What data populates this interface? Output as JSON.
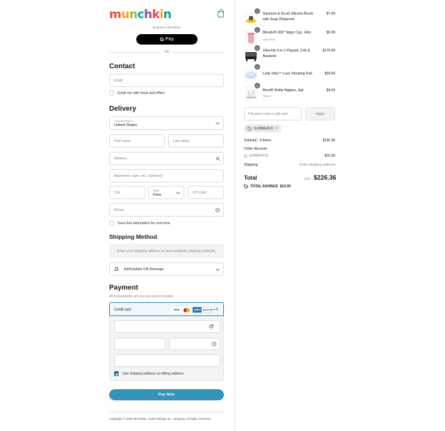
{
  "brand": {
    "logo_text": "munchkin",
    "logo_colors": [
      "#e94e3a",
      "#f7a21b",
      "#8bc43f",
      "#00a7a0",
      "#9c4a9c",
      "#e94e3a",
      "#f7a21b",
      "#00a7a0"
    ]
  },
  "express": {
    "label": "Express checkout",
    "gpay_label": "Pay",
    "gpay_g": "G",
    "or_label": "OR"
  },
  "contact": {
    "heading": "Contact",
    "email_placeholder": "Email",
    "newsletter_label": "Email me with news and offers"
  },
  "delivery": {
    "heading": "Delivery",
    "country_label": "Country/Region",
    "country_value": "United States",
    "first_name_ph": "First name",
    "last_name_ph": "Last name",
    "address_ph": "Address",
    "apartment_ph": "Apartment, suite, etc. (optional)",
    "city_ph": "City",
    "state_label": "State",
    "state_value": "Iowa",
    "zip_ph": "ZIP code",
    "phone_ph": "Phone",
    "save_info_label": "Save this information for next time"
  },
  "shipping": {
    "heading": "Shipping Method",
    "message": "Enter your shipping address to view available shipping methods.",
    "gift_label": "Add/Update Gift Message"
  },
  "payment": {
    "heading": "Payment",
    "note": "All transactions are secure and encrypted.",
    "credit_card_label": "Credit card",
    "cards": [
      "VISA",
      "MC",
      "AMEX",
      "DISCOVER"
    ],
    "more_cards": "+4",
    "billing_same_label": "Use shipping address as billing address",
    "pay_button": "Pay Now"
  },
  "footer": {
    "copyright": "Copyright © 2025 Munchkin, a Why Brands Inc. company. All rights reserved."
  },
  "cart": {
    "items": [
      {
        "qty": "1",
        "name": "Squeeze & Scrub Silicone Brush with Soap Dispenser",
        "variant": "",
        "price": "$7.99"
      },
      {
        "qty": "1",
        "name": "Miracle® 360° Sippy Cup, 14oz",
        "variant": "Light Pink",
        "price": "$9.99"
      },
      {
        "qty": "1",
        "name": "Ultra-lite 3-in-1 Playard, Crib & Bassinet",
        "variant": "",
        "price": "$179.99"
      },
      {
        "qty": "1",
        "name": "Lulla-Vibe™ Luxe Vibrating Pad",
        "variant": "",
        "price": "$34.99"
      },
      {
        "qty": "1",
        "name": "Bond® Bottle Nipples, 2pk",
        "variant": "Stage 1",
        "price": "$4.00"
      }
    ],
    "discount_placeholder": "Discount code or gift card",
    "apply_label": "Apply",
    "applied_code": "SUMMER10",
    "subtotal_label": "Subtotal · 5 items",
    "subtotal_value": "$236.36",
    "order_discount_label": "Order discount",
    "discount_code_label": "SUMMER10",
    "discount_value": "- $10.00",
    "shipping_label": "Shipping",
    "shipping_value": "Enter shipping address",
    "total_label": "Total",
    "currency": "USD",
    "total_value": "$226.36",
    "savings_label": "TOTAL SAVINGS",
    "savings_value": "$10.00"
  }
}
